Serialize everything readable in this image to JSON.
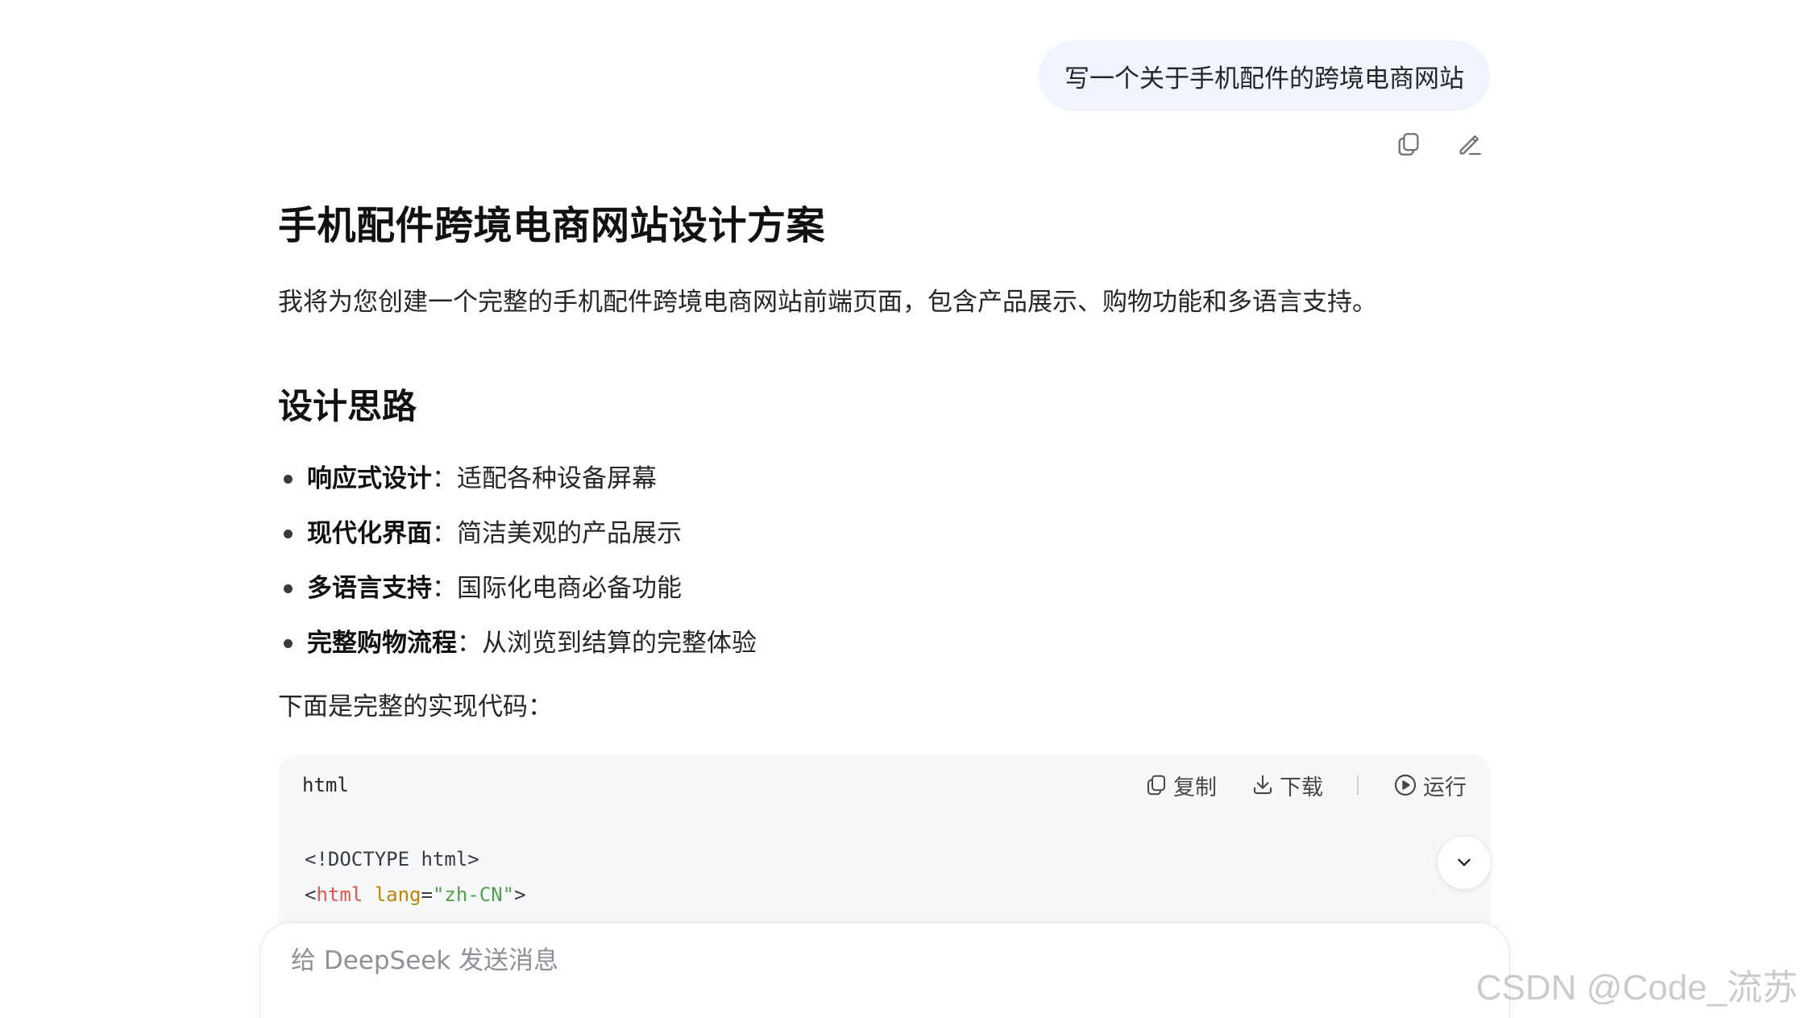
{
  "user_message": "写一个关于手机配件的跨境电商网站",
  "message_actions": {
    "copy_icon": "copy-icon",
    "edit_icon": "edit-icon"
  },
  "answer": {
    "title": "手机配件跨境电商网站设计方案",
    "intro": "我将为您创建一个完整的手机配件跨境电商网站前端页面，包含产品展示、购物功能和多语言支持。",
    "section_title": "设计思路",
    "points": [
      {
        "label": "响应式设计",
        "sep": "：",
        "text": "适配各种设备屏幕"
      },
      {
        "label": "现代化界面",
        "sep": "：",
        "text": "简洁美观的产品展示"
      },
      {
        "label": "多语言支持",
        "sep": "：",
        "text": "国际化电商必备功能"
      },
      {
        "label": "完整购物流程",
        "sep": "：",
        "text": "从浏览到结算的完整体验"
      }
    ],
    "code_lead": "下面是完整的实现代码："
  },
  "code_block": {
    "language": "html",
    "copy_label": "复制",
    "download_label": "下载",
    "run_label": "运行",
    "line1": "<!DOCTYPE html>",
    "line2_open": "<",
    "line2_tag": "html",
    "line2_attr": "lang",
    "line2_eq": "=",
    "line2_value": "\"zh-CN\"",
    "line2_close": ">"
  },
  "composer": {
    "placeholder": "给 DeepSeek 发送消息"
  },
  "watermark": "CSDN @Code_流苏",
  "colors": {
    "user_bubble": "#eff4ff",
    "code_bg": "#f7f8fa",
    "tag": "#e45649",
    "attr": "#c18401",
    "string": "#50a14f"
  }
}
